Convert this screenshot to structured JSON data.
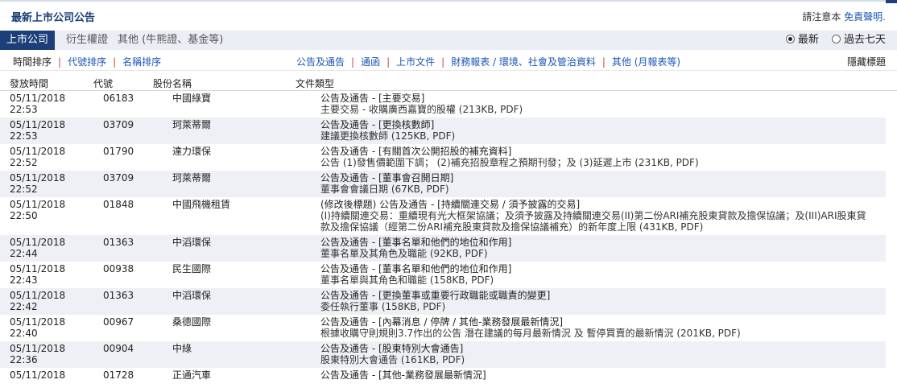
{
  "header": {
    "title": "最新上市公司公告",
    "notice_label": "請注意本",
    "notice_link": "免責聲明."
  },
  "tabs": [
    {
      "label": "上市公司"
    },
    {
      "label": "衍生權證"
    },
    {
      "label": "其他 (牛熊證、基金等)"
    }
  ],
  "radios": [
    {
      "label": "最新",
      "selected": true
    },
    {
      "label": "過去七天",
      "selected": false
    }
  ],
  "sort": {
    "time": "時間排序",
    "code": "代號排序",
    "name": "名稱排序"
  },
  "categories": [
    "公告及通告",
    "通函",
    "上市文件",
    "財務報表 / 環境、社會及管治資料",
    "其他 (月報表等)"
  ],
  "hide_label": "隱藏標題",
  "columns": {
    "time": "發放時間",
    "code": "代號",
    "name": "股份名稱",
    "type": "文件類型"
  },
  "rows": [
    {
      "date": "05/11/2018",
      "time": "22:53",
      "code": "06183",
      "name": "中國綠寶",
      "title": "公告及通告 - [主要交易]",
      "desc": "主要交易 - 收購廣西嘉寶的股權 (213KB, PDF)"
    },
    {
      "date": "05/11/2018",
      "time": "22:53",
      "code": "03709",
      "name": "珂萊蒂爾",
      "title": "公告及通告 - [更換核數師]",
      "desc": "建議更換核數師 (125KB, PDF)"
    },
    {
      "date": "05/11/2018",
      "time": "22:52",
      "code": "01790",
      "name": "達力環保",
      "title": "公告及通告 - [有關首次公開招股的補充資料]",
      "desc": "公告 (1)發售價範圍下調； (2)補充招股章程之預期刊發；及 (3)延遲上市 (231KB, PDF)"
    },
    {
      "date": "05/11/2018",
      "time": "22:52",
      "code": "03709",
      "name": "珂萊蒂爾",
      "title": "公告及通告 - [董事會召開日期]",
      "desc": "董事會會議日期 (67KB, PDF)"
    },
    {
      "date": "05/11/2018",
      "time": "22:50",
      "code": "01848",
      "name": "中國飛機租賃",
      "title": "(修改後標題) 公告及通告 - [持續關連交易 / 須予披露的交易]",
      "desc": "(I)持續關連交易：重續現有光大框架協議；及須予披露及持續關連交易(II)第二份ARI補充股東貸款及擔保協議；及(III)ARI股東貸款及擔保協議（經第二份ARI補充股東貸款及擔保協議補充）的新年度上限 (431KB, PDF)"
    },
    {
      "date": "05/11/2018",
      "time": "22:44",
      "code": "01363",
      "name": "中滔環保",
      "title": "公告及通告 - [董事名單和他們的地位和作用]",
      "desc": "董事名單及其角色及職能 (92KB, PDF)"
    },
    {
      "date": "05/11/2018",
      "time": "22:43",
      "code": "00938",
      "name": "民生國際",
      "title": "公告及通告 - [董事名單和他們的地位和作用]",
      "desc": "董事名單與其角色和職能 (158KB, PDF)"
    },
    {
      "date": "05/11/2018",
      "time": "22:42",
      "code": "01363",
      "name": "中滔環保",
      "title": "公告及通告 - [更換董事或重要行政職能或職責的變更]",
      "desc": "委任執行董事 (158KB, PDF)"
    },
    {
      "date": "05/11/2018",
      "time": "22:40",
      "code": "00967",
      "name": "桑德國際",
      "title": "公告及通告 - [內幕消息 / 停牌 / 其他-業務發展最新情況]",
      "desc": "根據收購守則規則3.7作出的公告 潛在建議的每月最新情況 及 暫停買賣的最新情況 (201KB, PDF)"
    },
    {
      "date": "05/11/2018",
      "time": "22:36",
      "code": "00904",
      "name": "中綠",
      "title": "公告及通告 - [股東特別大會通告]",
      "desc": "股東特別大會通告 (161KB, PDF)"
    },
    {
      "date": "05/11/2018",
      "time": "",
      "code": "01728",
      "name": "正通汽車",
      "title": "公告及通告 - [其他-業務發展最新情況]",
      "desc": ""
    }
  ]
}
